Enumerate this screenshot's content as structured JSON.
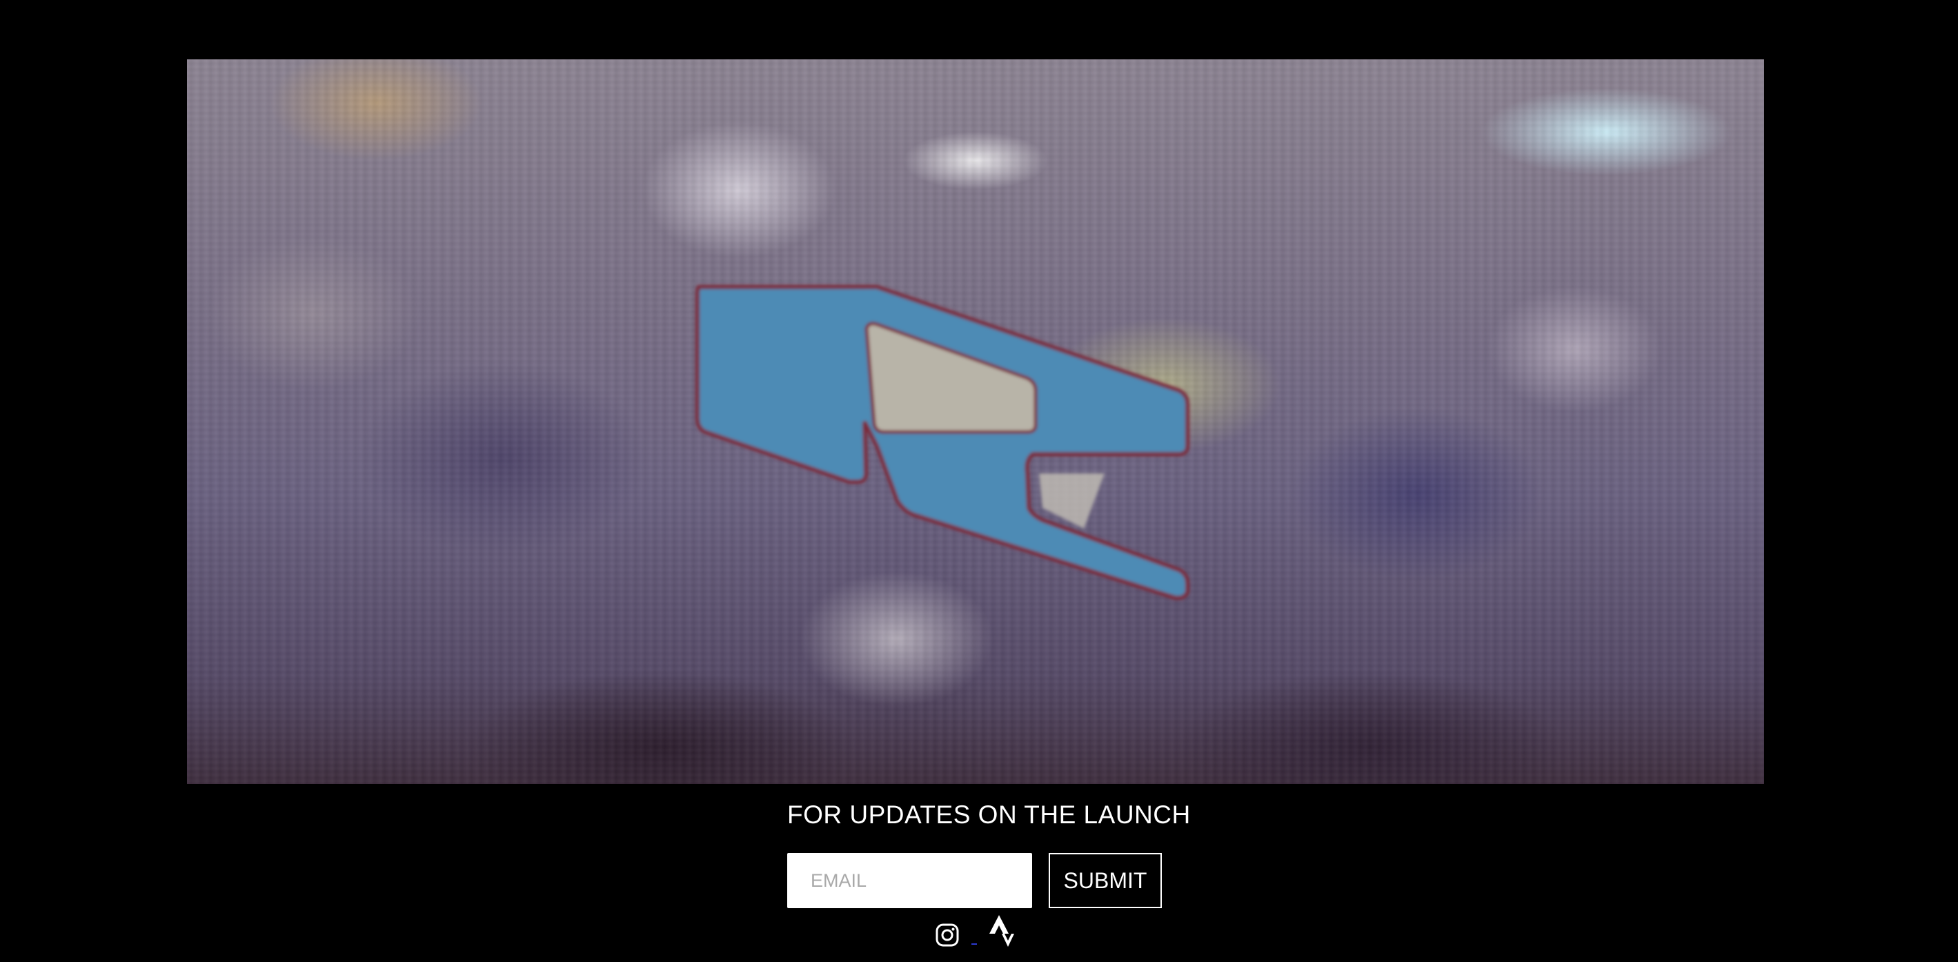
{
  "hero": {
    "logo_letter": "R",
    "colors": {
      "logo_fill": "#4d8bb5",
      "logo_outline": "#7a2a3a"
    }
  },
  "signup": {
    "caption": "FOR UPDATES ON THE LAUNCH",
    "email_placeholder": "EMAIL",
    "email_value": "",
    "submit_label": "SUBMIT"
  },
  "social": {
    "icons": [
      "instagram-icon",
      "strava-icon"
    ]
  },
  "theme": {
    "background": "#000000",
    "text": "#ffffff"
  }
}
